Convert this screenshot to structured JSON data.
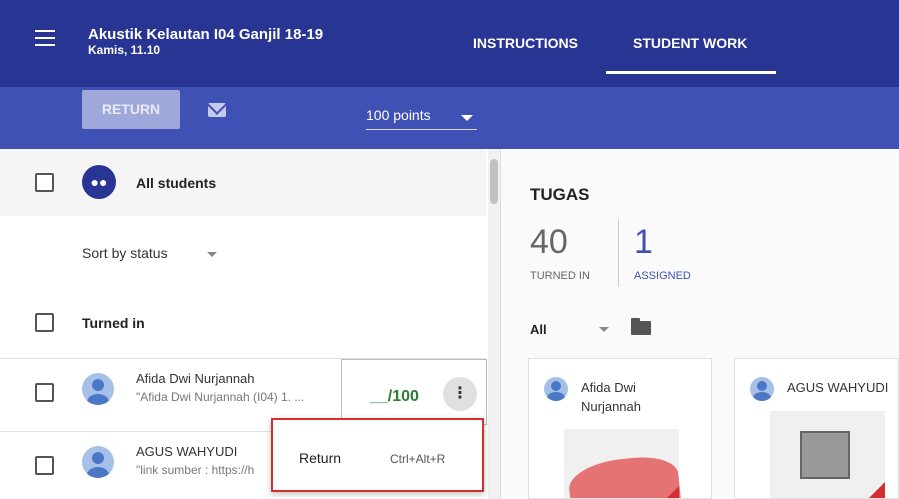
{
  "header": {
    "class_title": "Akustik Kelautan I04 Ganjil 18-19",
    "date": "Kamis, 11.10",
    "tabs": [
      {
        "label": "INSTRUCTIONS"
      },
      {
        "label": "STUDENT WORK"
      }
    ],
    "active_tab": "STUDENT WORK"
  },
  "toolbar": {
    "return_label": "RETURN",
    "points_value": "100 points"
  },
  "left": {
    "all_students_label": "All students",
    "sort_label": "Sort by status",
    "section_label": "Turned in",
    "students": [
      {
        "name": "Afida Dwi Nurjannah",
        "snippet": "\"Afida Dwi Nurjannah (I04) 1. ...",
        "grade": "__/100"
      },
      {
        "name": "AGUS WAHYUDI",
        "snippet": "\"link sumber : https://h"
      }
    ]
  },
  "context_menu": {
    "item_label": "Return",
    "shortcut": "Ctrl+Alt+R"
  },
  "right": {
    "assignment_title": "TUGAS",
    "turned_in_count": "40",
    "turned_in_label": "TURNED IN",
    "assigned_count": "1",
    "assigned_label": "ASSIGNED",
    "filter_value": "All",
    "cards": [
      {
        "name": "Afida Dwi Nurjannah"
      },
      {
        "name": "AGUS WAHYUDI"
      }
    ]
  },
  "colors": {
    "header_bg": "#283593",
    "toolbar_bg": "#3f51b5",
    "accent": "#3f51b5",
    "grade_green": "#2e7d32",
    "highlight_red": "#d32f2f"
  }
}
